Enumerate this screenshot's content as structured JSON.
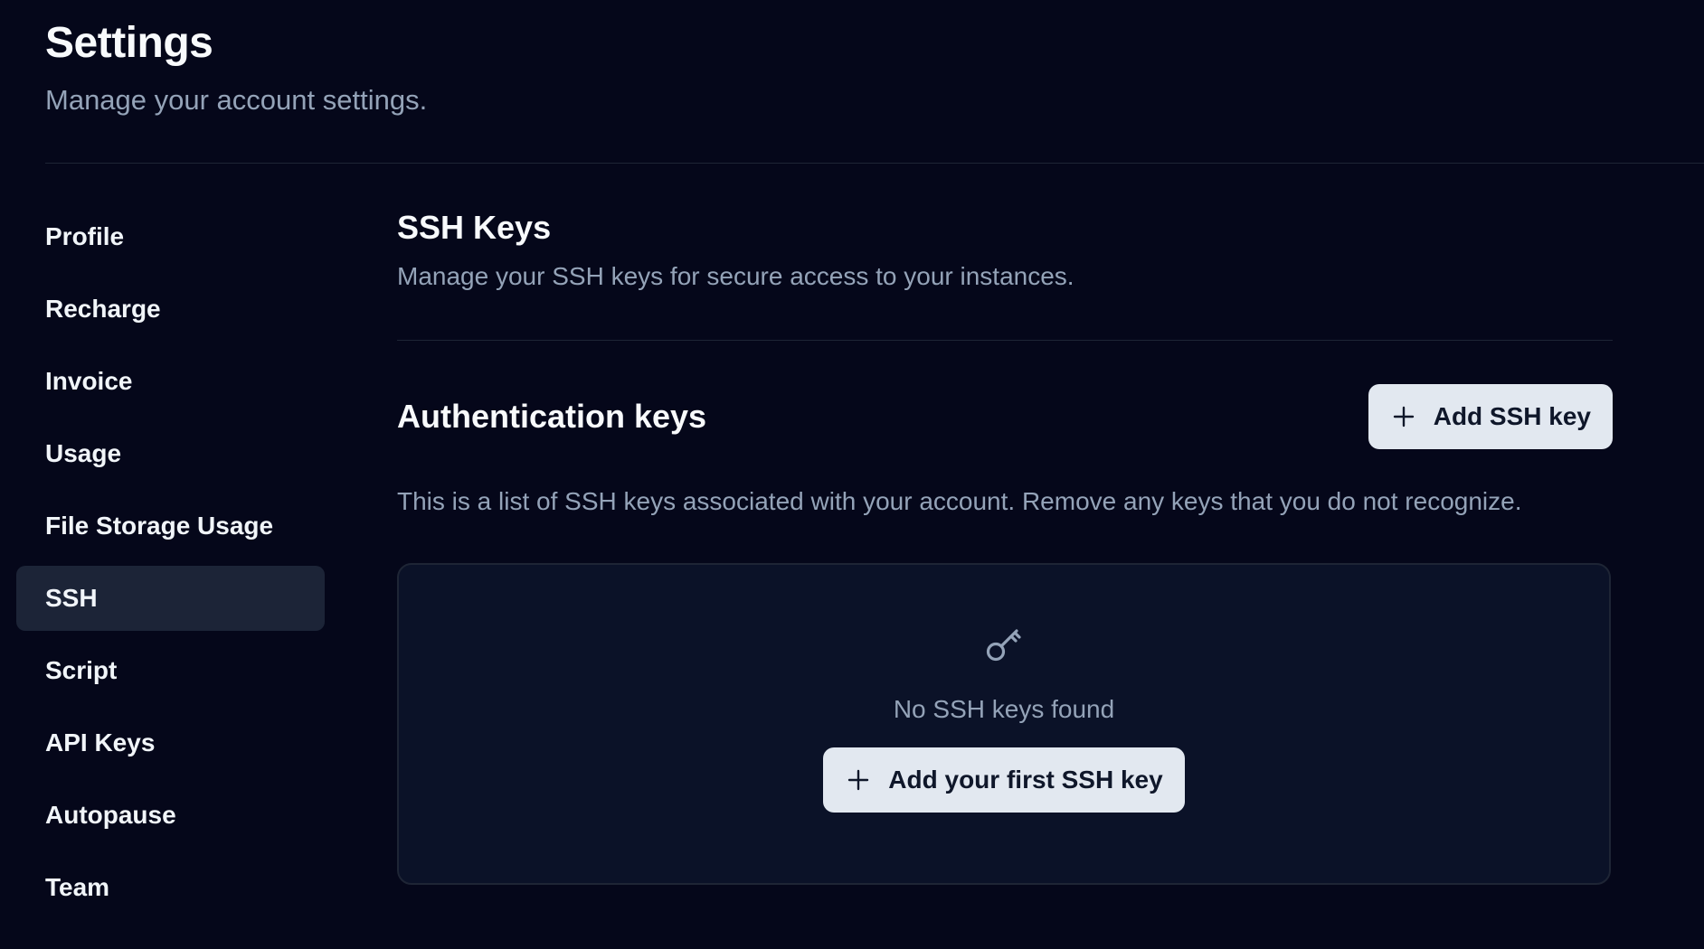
{
  "header": {
    "title": "Settings",
    "subtitle": "Manage your account settings."
  },
  "sidebar": {
    "items": [
      {
        "label": "Profile",
        "active": false
      },
      {
        "label": "Recharge",
        "active": false
      },
      {
        "label": "Invoice",
        "active": false
      },
      {
        "label": "Usage",
        "active": false
      },
      {
        "label": "File Storage Usage",
        "active": false
      },
      {
        "label": "SSH",
        "active": true
      },
      {
        "label": "Script",
        "active": false
      },
      {
        "label": "API Keys",
        "active": false
      },
      {
        "label": "Autopause",
        "active": false
      },
      {
        "label": "Team",
        "active": false
      }
    ]
  },
  "main": {
    "section_title": "SSH Keys",
    "section_description": "Manage your SSH keys for secure access to your instances.",
    "auth_title": "Authentication keys",
    "add_button_label": "Add SSH key",
    "add_button_icon": "plus-icon",
    "list_description": "This is a list of SSH keys associated with your account. Remove any keys that you do not recognize.",
    "empty_state": {
      "icon": "key-icon",
      "message": "No SSH keys found",
      "button_label": "Add your first SSH key",
      "button_icon": "plus-icon"
    }
  },
  "colors": {
    "background": "#05071a",
    "active_item_bg": "#1c2437",
    "muted_text": "#94a3b8",
    "button_bg": "#e2e8f0",
    "panel_bg": "#0b1228",
    "border": "#1e2535"
  }
}
